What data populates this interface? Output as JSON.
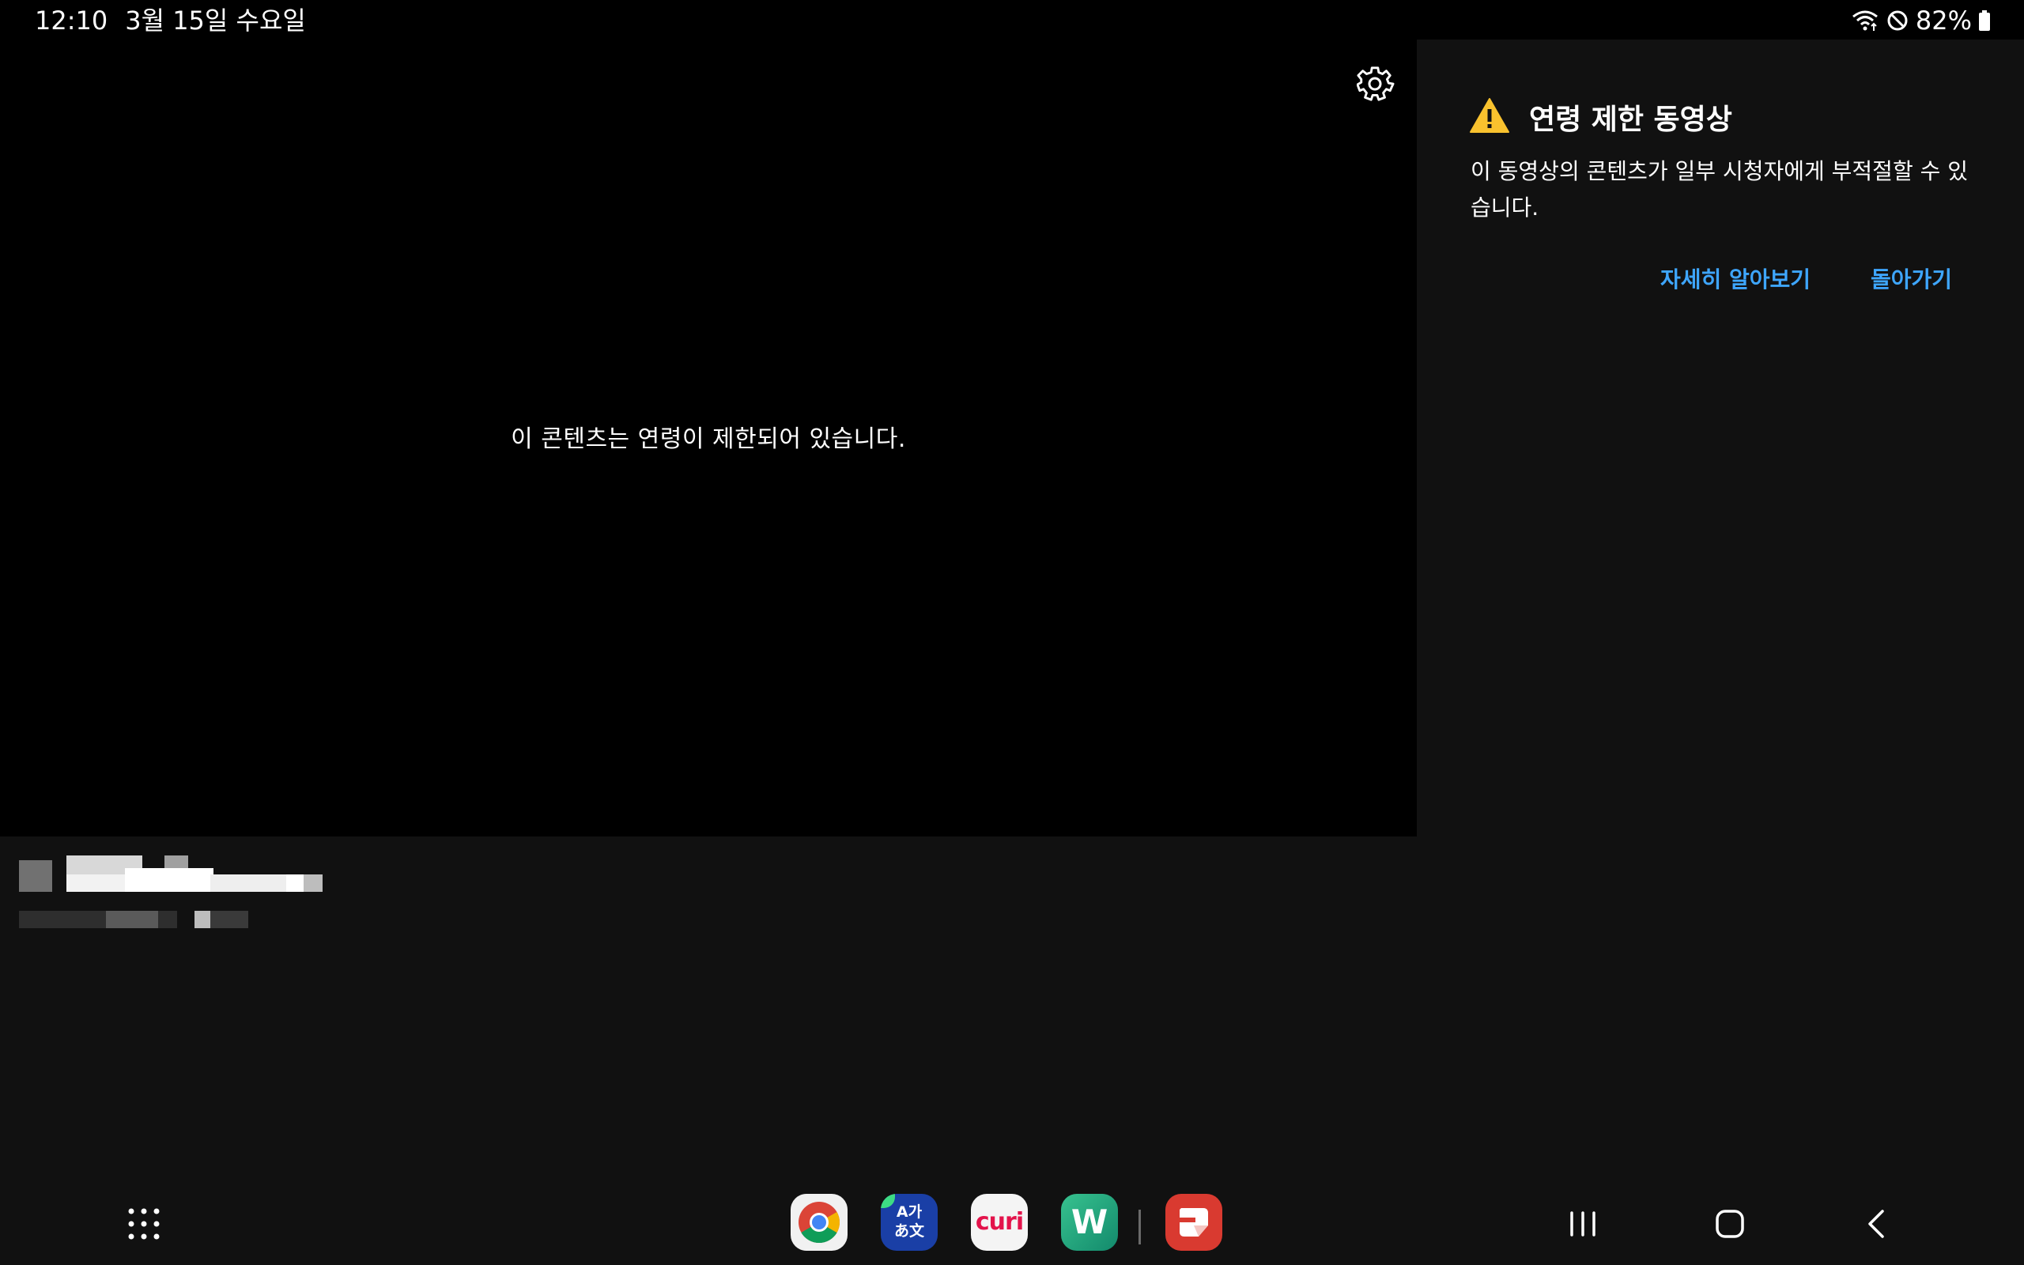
{
  "status_bar": {
    "time": "12:10",
    "date": "3월 15일 수요일",
    "battery_percent": "82%",
    "icons": [
      "wifi-icon",
      "do-not-disturb-icon",
      "battery-icon"
    ]
  },
  "video": {
    "restricted_message": "이 콘텐츠는 연령이 제한되어 있습니다.",
    "settings_icon": "gear-icon"
  },
  "panel": {
    "warning_icon": "warning-icon",
    "title": "연령 제한 동영상",
    "description": "이 동영상의 콘텐츠가 일부 시청자에게 부적절할 수 있습니다.",
    "learn_more": "자세히 알아보기",
    "go_back": "돌아가기"
  },
  "nav": {
    "apps_icon": "apps-grid-icon",
    "dock_apps": [
      {
        "name": "chrome",
        "icon": "chrome-icon"
      },
      {
        "name": "translate",
        "icon": "translate-icon",
        "label_top": "A가",
        "label_bottom": "あ文"
      },
      {
        "name": "curi",
        "icon": "curi-icon",
        "label": "curi"
      },
      {
        "name": "w-app",
        "icon": "w-app-icon",
        "label": "W"
      },
      {
        "name": "notes",
        "icon": "notes-icon"
      }
    ],
    "system_buttons": [
      "recents-icon",
      "home-icon",
      "back-icon"
    ]
  },
  "colors": {
    "accent_link": "#3ea6ff",
    "warning": "#f9c22e",
    "background": "#111111",
    "video_background": "#000000"
  }
}
